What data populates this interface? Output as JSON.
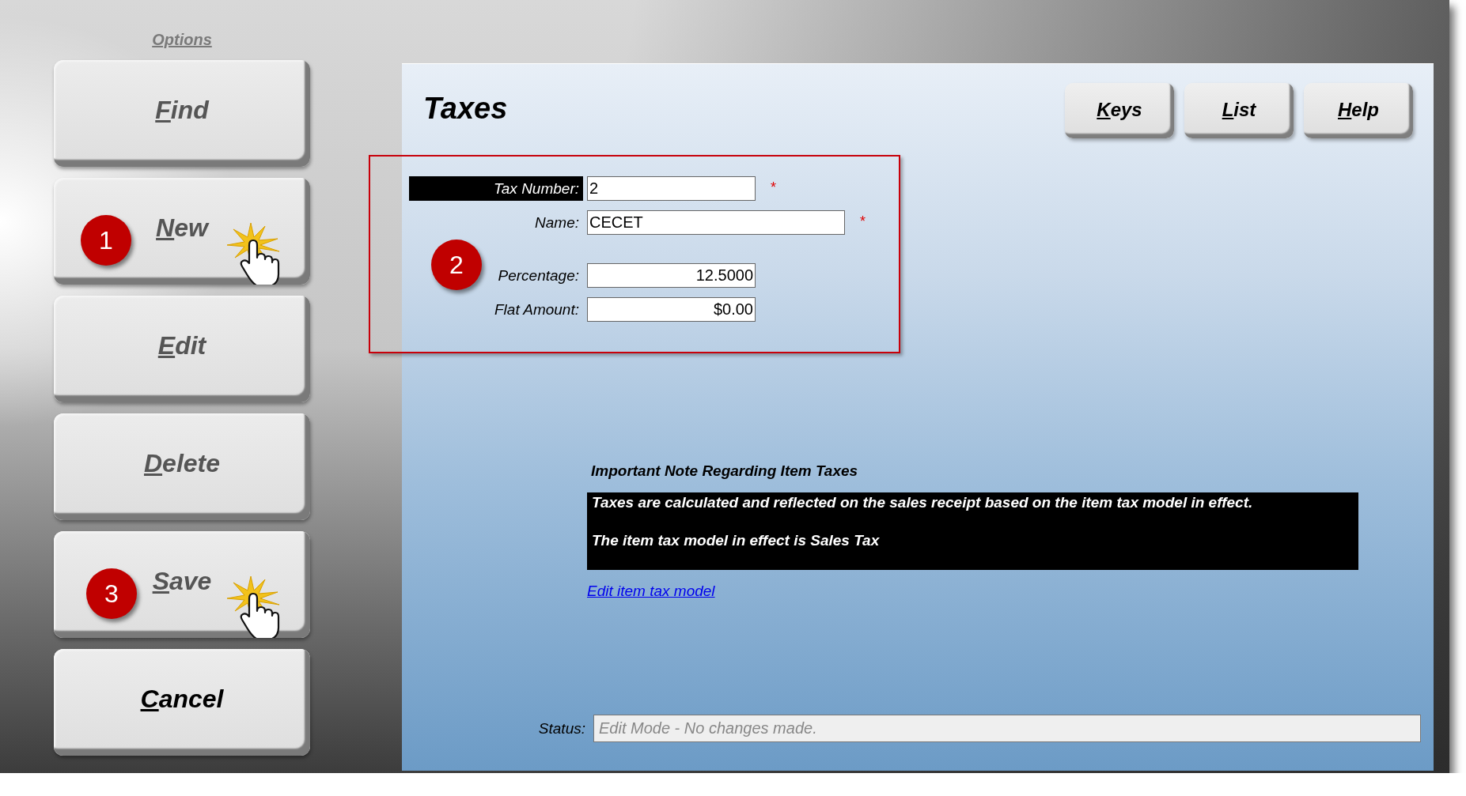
{
  "sidebar": {
    "title": "Options",
    "buttons": [
      {
        "label": "Find",
        "mnemonic": true,
        "disabled": true
      },
      {
        "label": "New",
        "mnemonic": true,
        "disabled": true,
        "callout": "1",
        "pointer": true
      },
      {
        "label": "Edit",
        "mnemonic": true,
        "disabled": true
      },
      {
        "label": "Delete",
        "mnemonic": true,
        "disabled": true
      },
      {
        "label": "Save",
        "mnemonic": true,
        "disabled": true,
        "callout": "3",
        "pointer": true
      },
      {
        "label": "Cancel",
        "mnemonic": true,
        "disabled": false
      }
    ]
  },
  "header": {
    "title": "Taxes",
    "buttons": [
      {
        "label": "Keys",
        "mnemonic": true
      },
      {
        "label": "List",
        "mnemonic": true
      },
      {
        "label": "Help",
        "mnemonic": true
      }
    ]
  },
  "form": {
    "callout": "2",
    "fields": [
      {
        "label": "Tax Number:",
        "value": "2",
        "focused": true,
        "kind": "code",
        "required_mark": "*"
      },
      {
        "label": "Name:",
        "value": "CECET",
        "focused": false,
        "kind": "text",
        "required_mark": "*"
      },
      {
        "label": "Percentage:",
        "value": "12.5000",
        "focused": false,
        "kind": "number"
      },
      {
        "label": "Flat Amount:",
        "value": "$0.00",
        "focused": false,
        "kind": "number"
      }
    ]
  },
  "note": {
    "heading": "Important Note Regarding Item Taxes",
    "lines": [
      "Taxes are calculated and reflected on the sales receipt based on the item tax model in effect.",
      "The item tax model in effect is Sales Tax"
    ],
    "link": "Edit item tax model"
  },
  "status": {
    "label": "Status:",
    "value": "Edit Mode - No changes made."
  }
}
